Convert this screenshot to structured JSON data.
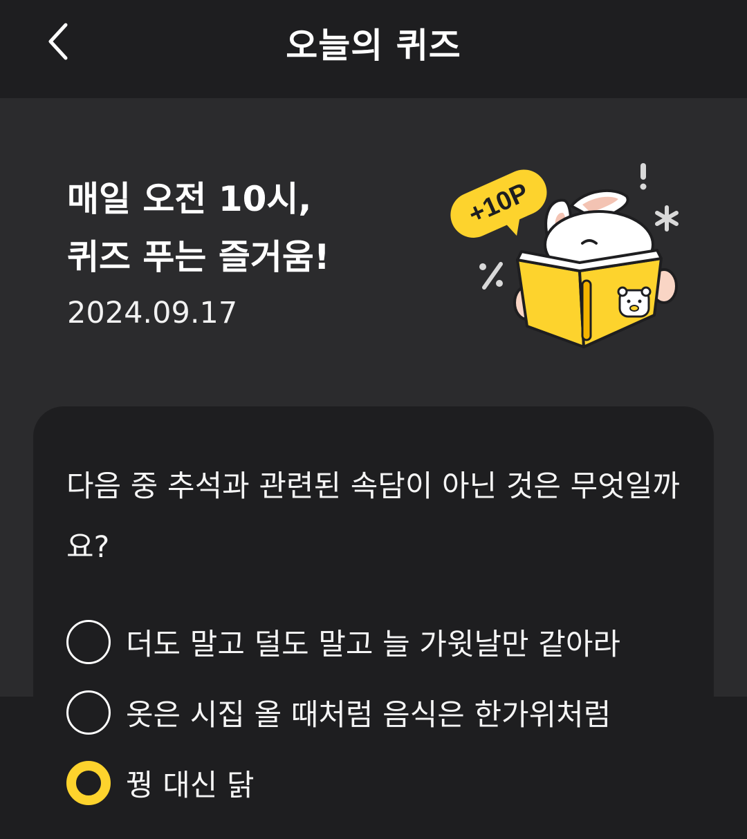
{
  "header": {
    "title": "오늘의 퀴즈",
    "back_icon": "chevron-left-icon"
  },
  "hero": {
    "line1": "매일 오전 10시,",
    "line2": "퀴즈 푸는 즐거움!",
    "date": "2024.09.17",
    "badge_text": "+10P",
    "badge_color": "#fdd32d",
    "book_color": "#fdd32d"
  },
  "quiz": {
    "question": "다음 중 추석과 관련된 속담이 아닌 것은 무엇일까요?",
    "options": [
      {
        "label": "더도 말고 덜도 말고 늘 가윗날만 같아라",
        "selected": false
      },
      {
        "label": "옷은 시집 올 때처럼 음식은 한가위처럼",
        "selected": false
      },
      {
        "label": "꿩 대신 닭",
        "selected": true
      }
    ],
    "accent_color": "#fdd32d"
  },
  "colors": {
    "background": "#1e1e20",
    "hero_background": "#2b2b2d",
    "text": "#ffffff"
  }
}
